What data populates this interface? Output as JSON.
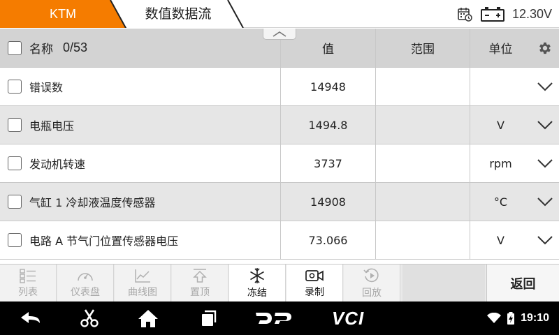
{
  "header": {
    "brand_tab": "KTM",
    "page_tab": "数值数据流",
    "voltage": "12.30V",
    "brand_color": "#f57c00"
  },
  "table": {
    "columns": {
      "name": "名称",
      "count": "0/53",
      "value": "值",
      "range": "范围",
      "unit": "单位"
    },
    "rows": [
      {
        "name": "错误数",
        "value": "14948",
        "range": "",
        "unit": ""
      },
      {
        "name": "电瓶电压",
        "value": "1494.8",
        "range": "",
        "unit": "V"
      },
      {
        "name": "发动机转速",
        "value": "3737",
        "range": "",
        "unit": "rpm"
      },
      {
        "name": "气缸 1 冷却液温度传感器",
        "value": "14908",
        "range": "",
        "unit": "°C"
      },
      {
        "name": "电路 A 节气门位置传感器电压",
        "value": "73.066",
        "range": "",
        "unit": "V"
      }
    ]
  },
  "toolbar": {
    "list": "列表",
    "gauge": "仪表盘",
    "graph": "曲线图",
    "top": "置顶",
    "freeze": "冻结",
    "record": "录制",
    "playback": "回放",
    "back": "返回"
  },
  "navbar": {
    "dp": "DP",
    "vci": "VCI",
    "time": "19:10"
  }
}
